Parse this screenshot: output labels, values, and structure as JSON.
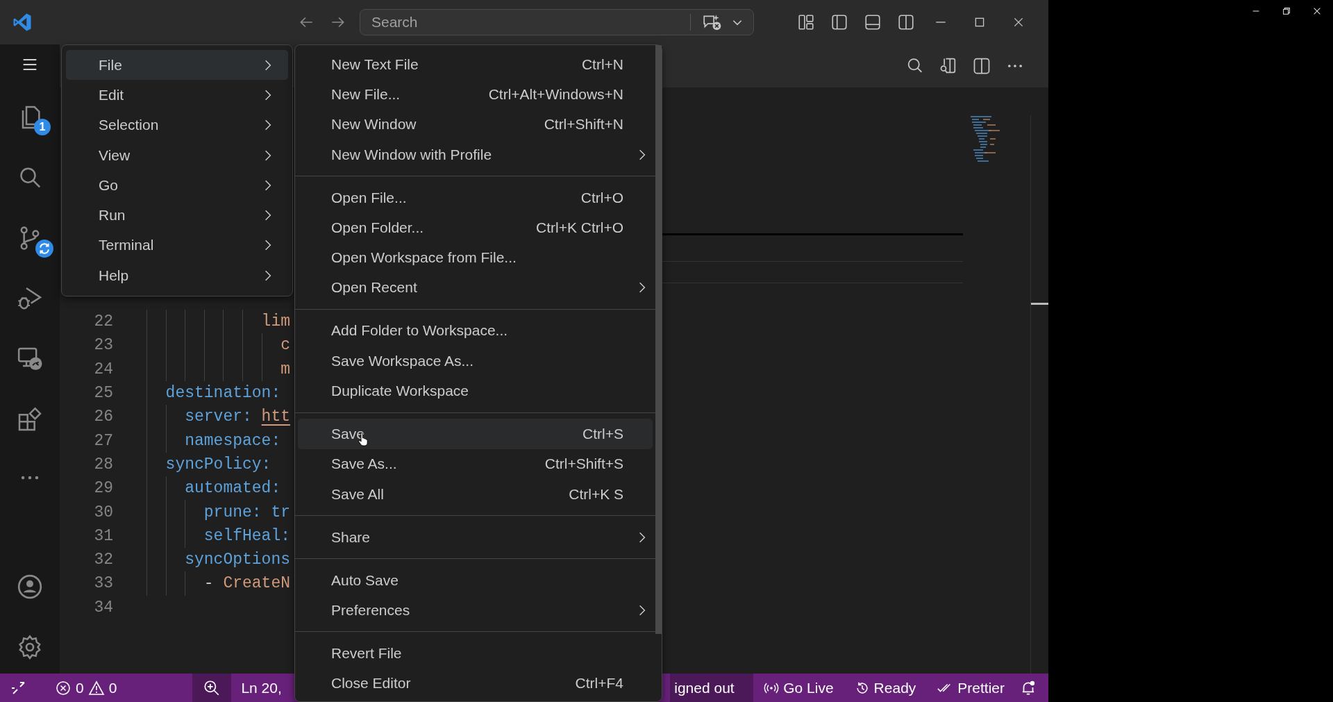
{
  "title_bar": {
    "search": {
      "placeholder": "Search"
    }
  },
  "activity_bar": {
    "explorer_badge": "1"
  },
  "menu_bar": {
    "items": [
      {
        "label": "File",
        "selected": true
      },
      {
        "label": "Edit",
        "selected": false
      },
      {
        "label": "Selection",
        "selected": false
      },
      {
        "label": "View",
        "selected": false
      },
      {
        "label": "Go",
        "selected": false
      },
      {
        "label": "Run",
        "selected": false
      },
      {
        "label": "Terminal",
        "selected": false
      },
      {
        "label": "Help",
        "selected": false
      }
    ]
  },
  "file_menu": {
    "groups": [
      [
        {
          "label": "New Text File",
          "shortcut": "Ctrl+N",
          "submenu": false,
          "highlighted": false
        },
        {
          "label": "New File...",
          "shortcut": "Ctrl+Alt+Windows+N",
          "submenu": false,
          "highlighted": false
        },
        {
          "label": "New Window",
          "shortcut": "Ctrl+Shift+N",
          "submenu": false,
          "highlighted": false
        },
        {
          "label": "New Window with Profile",
          "submenu": true,
          "highlighted": false
        }
      ],
      [
        {
          "label": "Open File...",
          "shortcut": "Ctrl+O",
          "submenu": false,
          "highlighted": false
        },
        {
          "label": "Open Folder...",
          "shortcut": "Ctrl+K Ctrl+O",
          "submenu": false,
          "highlighted": false
        },
        {
          "label": "Open Workspace from File...",
          "submenu": false,
          "highlighted": false
        },
        {
          "label": "Open Recent",
          "submenu": true,
          "highlighted": false
        }
      ],
      [
        {
          "label": "Add Folder to Workspace...",
          "submenu": false,
          "highlighted": false
        },
        {
          "label": "Save Workspace As...",
          "submenu": false,
          "highlighted": false
        },
        {
          "label": "Duplicate Workspace",
          "submenu": false,
          "highlighted": false
        }
      ],
      [
        {
          "label": "Save",
          "shortcut": "Ctrl+S",
          "submenu": false,
          "highlighted": true
        },
        {
          "label": "Save As...",
          "shortcut": "Ctrl+Shift+S",
          "submenu": false,
          "highlighted": false
        },
        {
          "label": "Save All",
          "shortcut": "Ctrl+K S",
          "submenu": false,
          "highlighted": false
        }
      ],
      [
        {
          "label": "Share",
          "submenu": true,
          "highlighted": false
        }
      ],
      [
        {
          "label": "Auto Save",
          "submenu": false,
          "highlighted": false
        },
        {
          "label": "Preferences",
          "submenu": true,
          "highlighted": false
        }
      ],
      [
        {
          "label": "Revert File",
          "submenu": false,
          "highlighted": false
        },
        {
          "label": "Close Editor",
          "shortcut": "Ctrl+F4",
          "submenu": false,
          "highlighted": false
        }
      ]
    ]
  },
  "editor": {
    "lines": [
      {
        "children": [
          {
            "children": [
              {
                "children": [
                  {
                    "children": [
                      {
                        "children": [
                          {
                            "children": [
                              {
                                "number": "22",
                                "code": [
                                  {
                                    "kind": "value",
                                    "text": "lim"
                                  }
                                ]
                              },
                              {
                                "children": [
                                  {
                                    "number": "23",
                                    "code": [
                                      {
                                        "kind": "value",
                                        "text": "c"
                                      }
                                    ]
                                  },
                                  {
                                    "number": "24",
                                    "code": [
                                      {
                                        "kind": "value",
                                        "text": "m"
                                      }
                                    ]
                                  }
                                ]
                              }
                            ]
                          }
                        ]
                      }
                    ]
                  }
                ]
              }
            ]
          },
          {
            "number": "25",
            "code": [
              {
                "kind": "key",
                "text": "destination:"
              }
            ]
          },
          {
            "children": [
              {
                "number": "26",
                "code": [
                  {
                    "kind": "key",
                    "text": "server:"
                  },
                  {
                    "kind": "link",
                    "text": "htt"
                  }
                ]
              },
              {
                "number": "27",
                "code": [
                  {
                    "kind": "key",
                    "text": "namespace:"
                  }
                ]
              }
            ]
          },
          {
            "number": "28",
            "code": [
              {
                "kind": "key",
                "text": "syncPolicy:"
              }
            ]
          },
          {
            "children": [
              {
                "number": "29",
                "code": [
                  {
                    "kind": "key",
                    "text": "automated:"
                  }
                ]
              },
              {
                "children": [
                  {
                    "number": "30",
                    "code": [
                      {
                        "kind": "key",
                        "text": "prune: tr"
                      }
                    ]
                  },
                  {
                    "number": "31",
                    "code": [
                      {
                        "kind": "key",
                        "text": "selfHeal:"
                      }
                    ]
                  }
                ]
              },
              {
                "number": "32",
                "code": [
                  {
                    "kind": "key",
                    "text": "syncOptions"
                  }
                ]
              },
              {
                "children": [
                  {
                    "number": "33",
                    "code": [
                      {
                        "kind": "plain",
                        "text": "-"
                      },
                      {
                        "kind": "value",
                        "text": "CreateN"
                      }
                    ]
                  }
                ]
              }
            ]
          }
        ]
      },
      {
        "number": "34"
      }
    ]
  },
  "status_bar": {
    "errors": "0",
    "warnings": "0",
    "position": "Ln 20,",
    "account": "igned out",
    "go_live": "Go Live",
    "ready": "Ready",
    "prettier": "Prettier"
  }
}
